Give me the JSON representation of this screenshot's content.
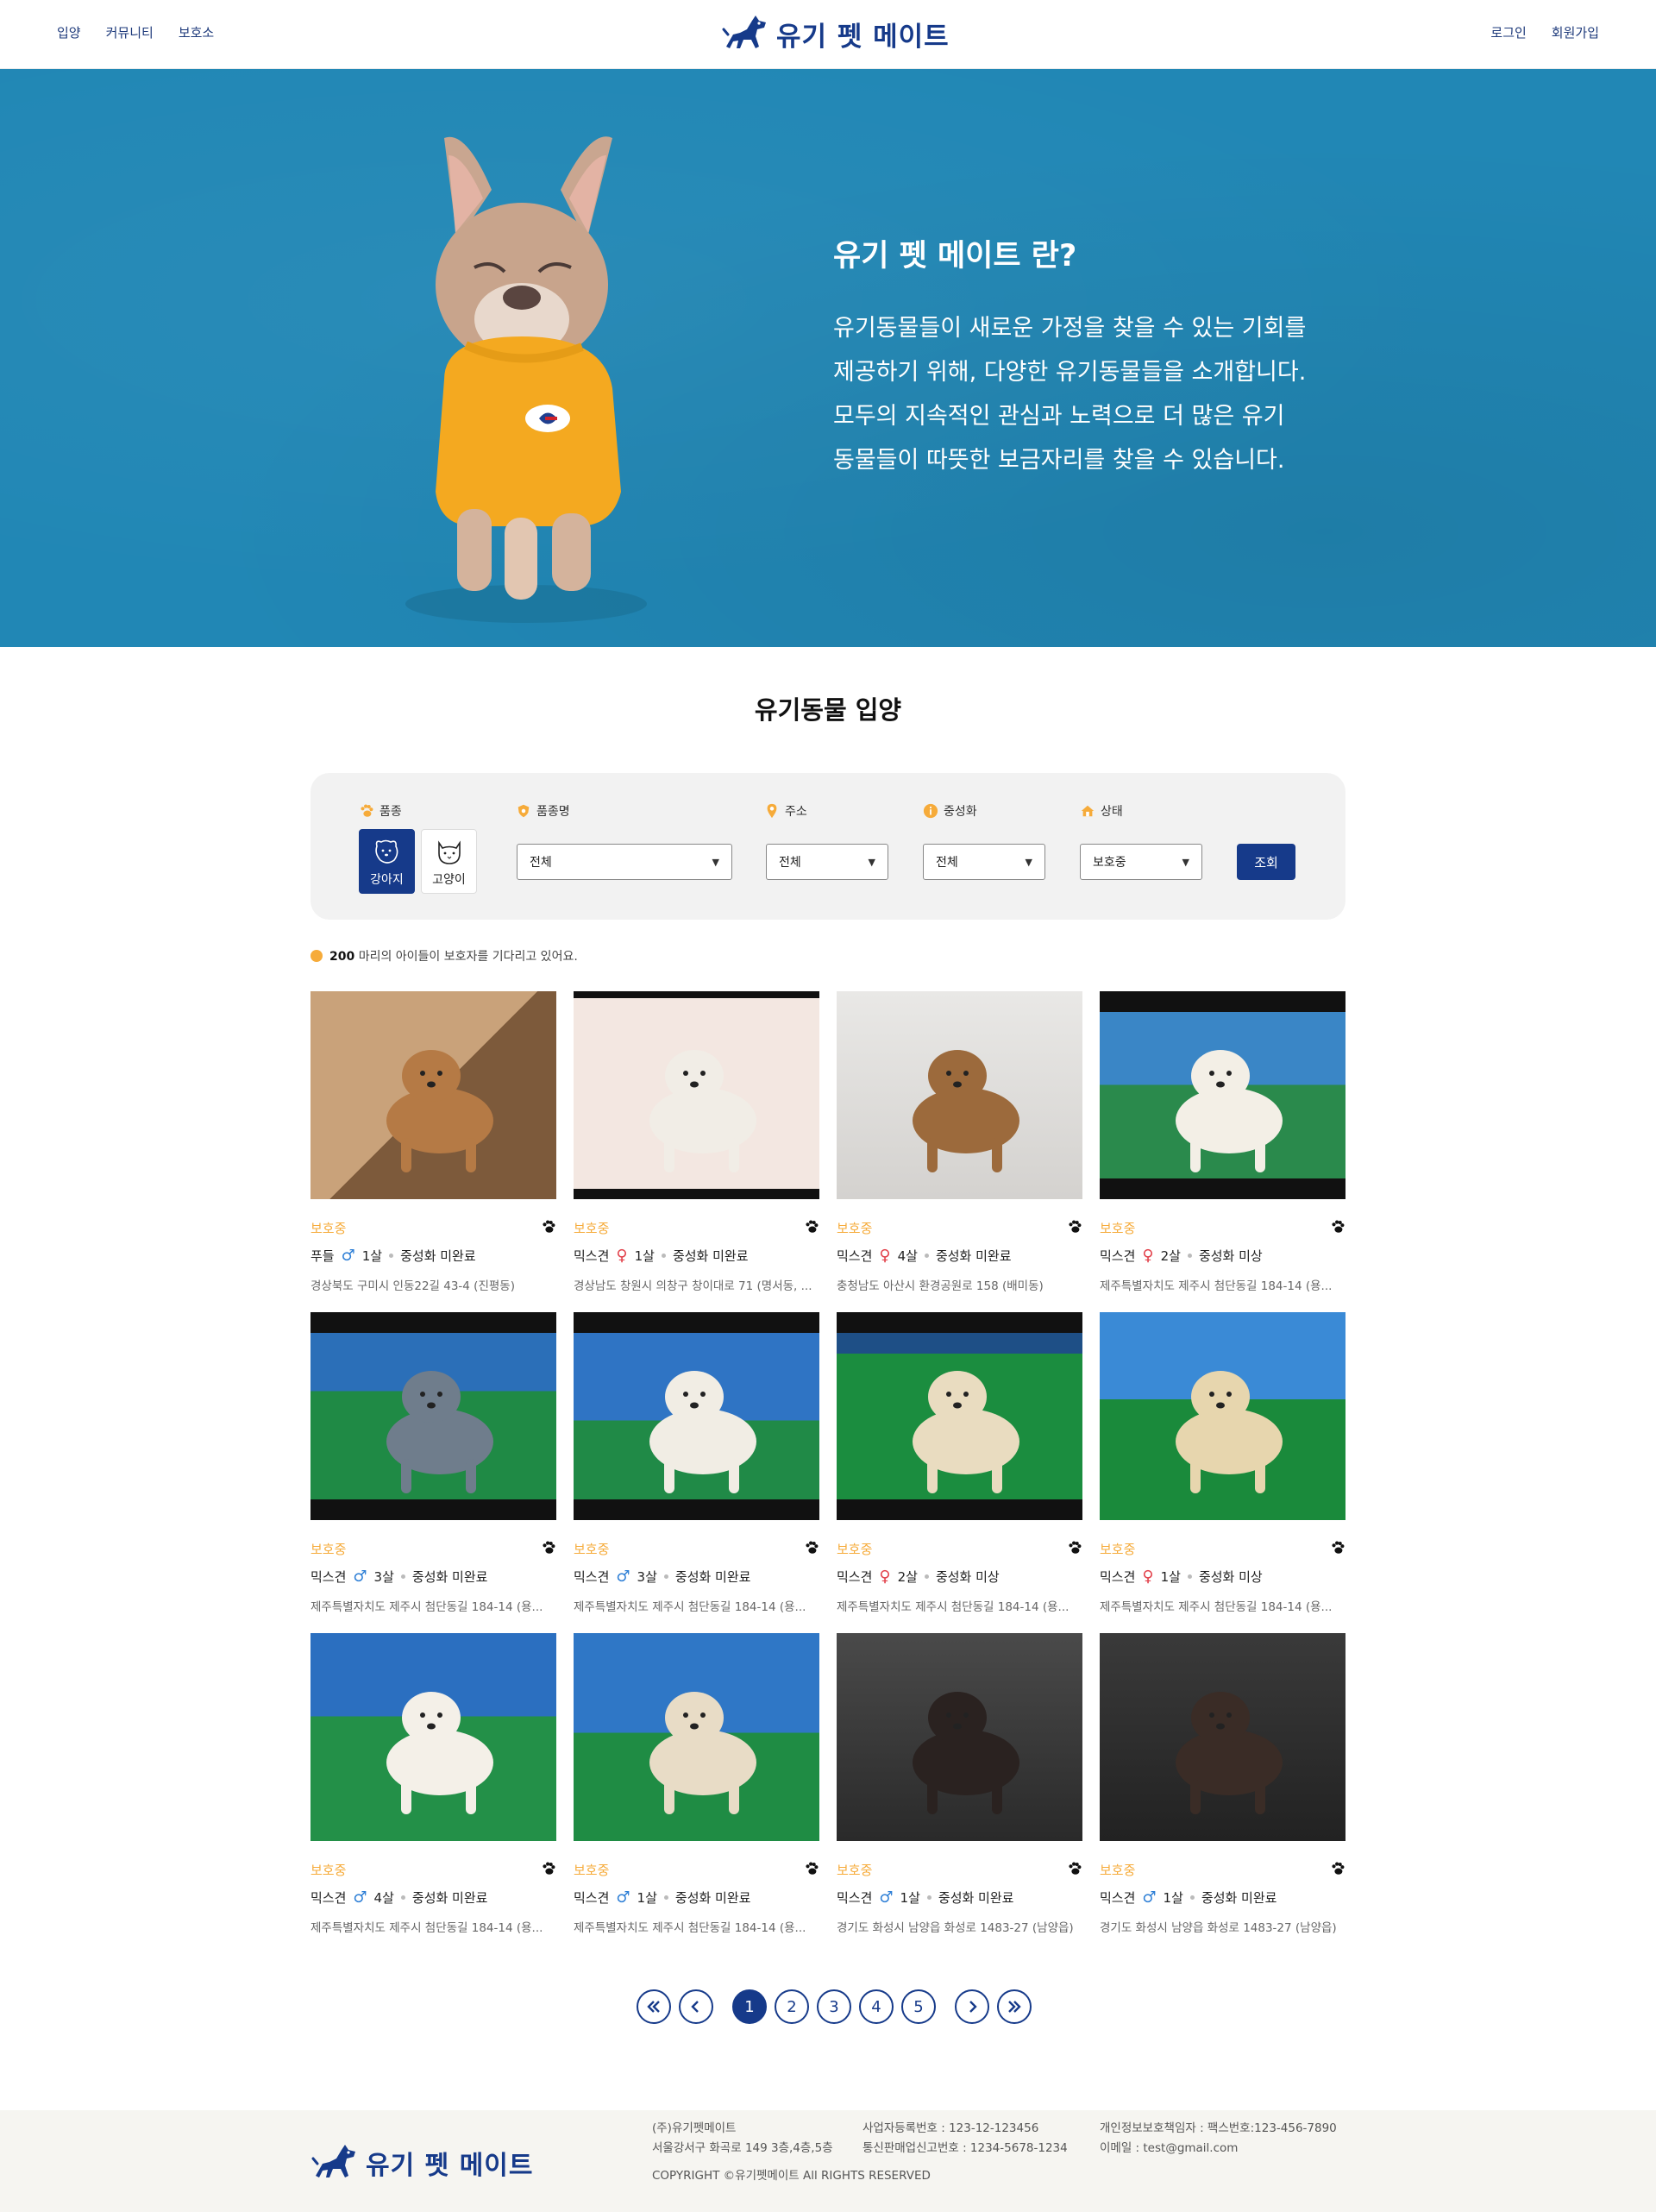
{
  "header": {
    "nav_left": [
      "입양",
      "커뮤니티",
      "보호소"
    ],
    "logo_text": "유기 펫 메이트",
    "nav_right": [
      "로그인",
      "회원가입"
    ]
  },
  "hero": {
    "title": "유기 펫 메이트 란?",
    "lines": [
      "유기동물들이 새로운 가정을 찾을 수 있는 기회를",
      "제공하기 위해, 다양한 유기동물들을 소개합니다.",
      "모두의 지속적인 관심과 노력으로 더 많은 유기",
      "동물들이 따뜻한 보금자리를 찾을 수 있습니다."
    ]
  },
  "section_title": "유기동물 입양",
  "filter": {
    "labels": {
      "species": "품종",
      "breed": "품종명",
      "address": "주소",
      "neutered": "중성화",
      "status": "상태"
    },
    "species": [
      {
        "label": "강아지",
        "active": true
      },
      {
        "label": "고양이",
        "active": false
      }
    ],
    "breed_value": "전체",
    "address_value": "전체",
    "neutered_value": "전체",
    "status_value": "보호중",
    "search_label": "조회"
  },
  "count": {
    "number": "200",
    "text": "마리의 아이들이 보호자를 기다리고 있어요."
  },
  "animals": [
    {
      "status": "보호중",
      "breed": "푸들",
      "gender": "male",
      "age": "1살",
      "neuter": "중성화 미완료",
      "address": "경상북도 구미시 인동22길 43-4 (진평동)"
    },
    {
      "status": "보호중",
      "breed": "믹스견",
      "gender": "female",
      "age": "1살",
      "neuter": "중성화 미완료",
      "address": "경상남도 창원시 의창구 창이대로 71 (명서동, ..."
    },
    {
      "status": "보호중",
      "breed": "믹스견",
      "gender": "female",
      "age": "4살",
      "neuter": "중성화 미완료",
      "address": "충청남도 아산시 환경공원로 158 (배미동)"
    },
    {
      "status": "보호중",
      "breed": "믹스견",
      "gender": "female",
      "age": "2살",
      "neuter": "중성화 미상",
      "address": "제주특별자치도 제주시 첨단동길 184-14 (용..."
    },
    {
      "status": "보호중",
      "breed": "믹스견",
      "gender": "male",
      "age": "3살",
      "neuter": "중성화 미완료",
      "address": "제주특별자치도 제주시 첨단동길 184-14 (용..."
    },
    {
      "status": "보호중",
      "breed": "믹스견",
      "gender": "male",
      "age": "3살",
      "neuter": "중성화 미완료",
      "address": "제주특별자치도 제주시 첨단동길 184-14 (용..."
    },
    {
      "status": "보호중",
      "breed": "믹스견",
      "gender": "female",
      "age": "2살",
      "neuter": "중성화 미상",
      "address": "제주특별자치도 제주시 첨단동길 184-14 (용..."
    },
    {
      "status": "보호중",
      "breed": "믹스견",
      "gender": "female",
      "age": "1살",
      "neuter": "중성화 미상",
      "address": "제주특별자치도 제주시 첨단동길 184-14 (용..."
    },
    {
      "status": "보호중",
      "breed": "믹스견",
      "gender": "male",
      "age": "4살",
      "neuter": "중성화 미완료",
      "address": "제주특별자치도 제주시 첨단동길 184-14 (용..."
    },
    {
      "status": "보호중",
      "breed": "믹스견",
      "gender": "male",
      "age": "1살",
      "neuter": "중성화 미완료",
      "address": "제주특별자치도 제주시 첨단동길 184-14 (용..."
    },
    {
      "status": "보호중",
      "breed": "믹스견",
      "gender": "male",
      "age": "1살",
      "neuter": "중성화 미완료",
      "address": "경기도 화성시 남양읍 화성로 1483-27 (남양읍)"
    },
    {
      "status": "보호중",
      "breed": "믹스견",
      "gender": "male",
      "age": "1살",
      "neuter": "중성화 미완료",
      "address": "경기도 화성시 남양읍 화성로 1483-27 (남양읍)"
    }
  ],
  "pagination": {
    "pages": [
      "1",
      "2",
      "3",
      "4",
      "5"
    ],
    "current": "1"
  },
  "footer": {
    "logo_text": "유기 펫 메이트",
    "company": "(주)유기펫메이트",
    "address": "서울강서구 화곡로 149 3층,4층,5층",
    "copyright": "COPYRIGHT ©유기펫메이트 All RIGHTS RESERVED",
    "biz_no": "사업자등록번호 : 123-12-123456",
    "mail_order": "통신판매업신고번호 : 1234-5678-1234",
    "privacy": "개인정보보호책임자 : 팩스번호:123-456-7890",
    "email": "이메일 : test@gmail.com"
  },
  "colors": {
    "brand": "#163a8a",
    "hero_bg": "#2187b5",
    "accent": "#f6ab3a",
    "male": "#2e7fd6",
    "female": "#e2404a"
  }
}
